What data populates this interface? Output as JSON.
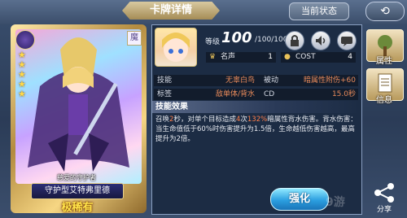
{
  "header": {
    "title": "卡牌详情",
    "state_button": "当前状态",
    "back_icon": "back-arrow-icon"
  },
  "card": {
    "stars": 5,
    "type_badge": "魔",
    "subtitle": "慈爱的守护者",
    "name": "守护型艾特弗里德",
    "rarity": "极稀有"
  },
  "info": {
    "level_label": "等级",
    "level": "100",
    "level_max": "/100/100",
    "fame_label": "名声",
    "fame_value": "1",
    "cost_label": "COST",
    "cost_value": "4",
    "rows": [
      {
        "label": "技能",
        "value": "无辜白鸟",
        "label2": "被动",
        "value2": "暗属性附伤+60"
      },
      {
        "label": "标签",
        "value": "敌单体/背水",
        "label2": "CD",
        "value2": "15.0秒"
      }
    ],
    "skill_title": "技能效果",
    "skill_desc_parts": [
      {
        "text": "召唤",
        "hl": false
      },
      {
        "text": "2",
        "hl": true
      },
      {
        "text": "秒，对单个目标造成",
        "hl": false
      },
      {
        "text": "4",
        "hl": true
      },
      {
        "text": "次",
        "hl": false
      },
      {
        "text": "132%",
        "hl": true
      },
      {
        "text": "暗属性背水伤害。背水伤害：当生命值低于60%时伤害提升为1.5倍，生命越低伤害越高，最高提升为2倍。",
        "hl": false
      }
    ]
  },
  "side": {
    "attribute_label": "属性",
    "info_label": "信息"
  },
  "footer": {
    "enhance_label": "强化",
    "share_label": "分享",
    "watermark": "9游"
  },
  "colors": {
    "highlight": "#ff7f4a",
    "rarity": "#ffe34a",
    "enhance": "#2b9fe0"
  }
}
